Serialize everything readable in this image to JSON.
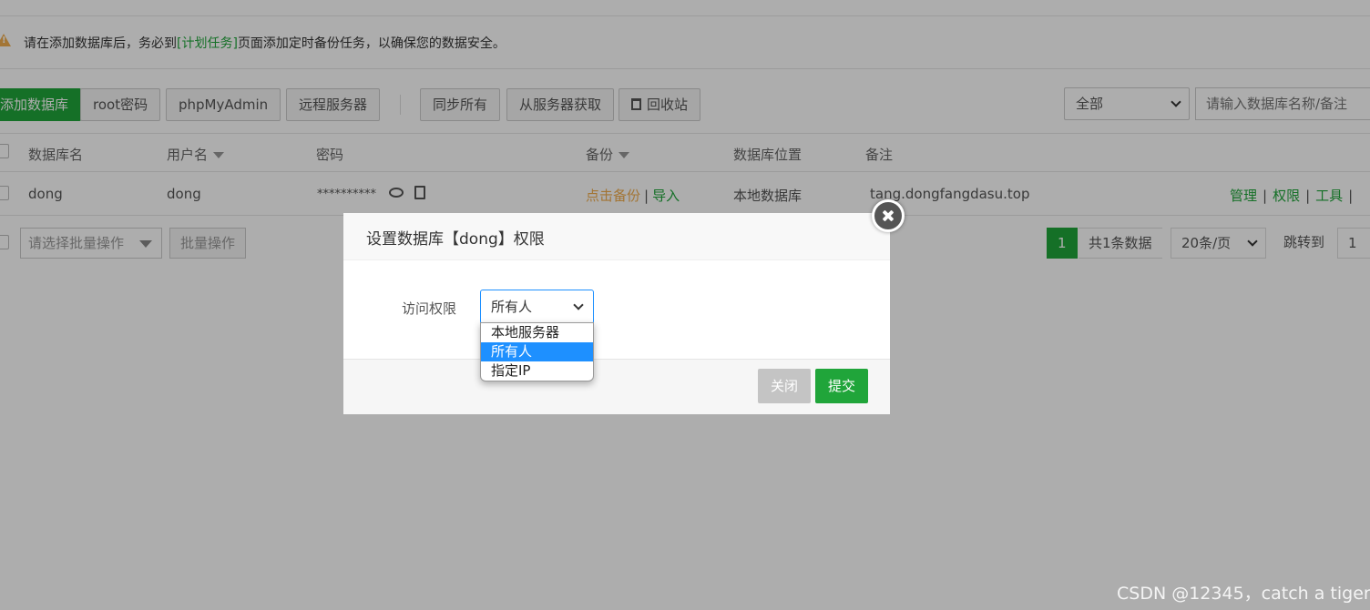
{
  "notice": {
    "prefix": "请在添加数据库后，务必到",
    "link": "[计划任务]",
    "suffix": "页面添加定时备份任务，以确保您的数据安全。"
  },
  "toolbar": {
    "add_db": "添加数据库",
    "root_pwd": "root密码",
    "phpmyadmin": "phpMyAdmin",
    "remote_server": "远程服务器",
    "sync_all": "同步所有",
    "fetch_from_server": "从服务器获取",
    "recycle_bin": "回收站",
    "filter_value": "全部",
    "search_placeholder": "请输入数据库名称/备注"
  },
  "table": {
    "headers": {
      "db_name": "数据库名",
      "username": "用户名",
      "password": "密码",
      "backup": "备份",
      "location": "数据库位置",
      "remark": "备注"
    },
    "rows": [
      {
        "db_name": "dong",
        "username": "dong",
        "password": "**********",
        "backup_link": "点击备份",
        "import_link": "导入",
        "location": "本地数据库",
        "remark": "tang.dongfangdasu.top",
        "actions": [
          "管理",
          "权限",
          "工具"
        ]
      }
    ]
  },
  "footer": {
    "batch_placeholder": "请选择批量操作",
    "batch_button": "批量操作",
    "current_page": "1",
    "total": "共1条数据",
    "page_size": "20条/页",
    "jump_label": "跳转到",
    "jump_value": "1"
  },
  "dialog": {
    "title": "设置数据库【dong】权限",
    "access_label": "访问权限",
    "selected": "所有人",
    "options": [
      "本地服务器",
      "所有人",
      "指定IP"
    ],
    "close_button": "关闭",
    "submit_button": "提交"
  },
  "watermark": "CSDN @12345，catch a tiger",
  "colors": {
    "brand_green": "#20a53a",
    "warning_orange": "#f0ad4e",
    "select_blue": "#1e90ff"
  }
}
